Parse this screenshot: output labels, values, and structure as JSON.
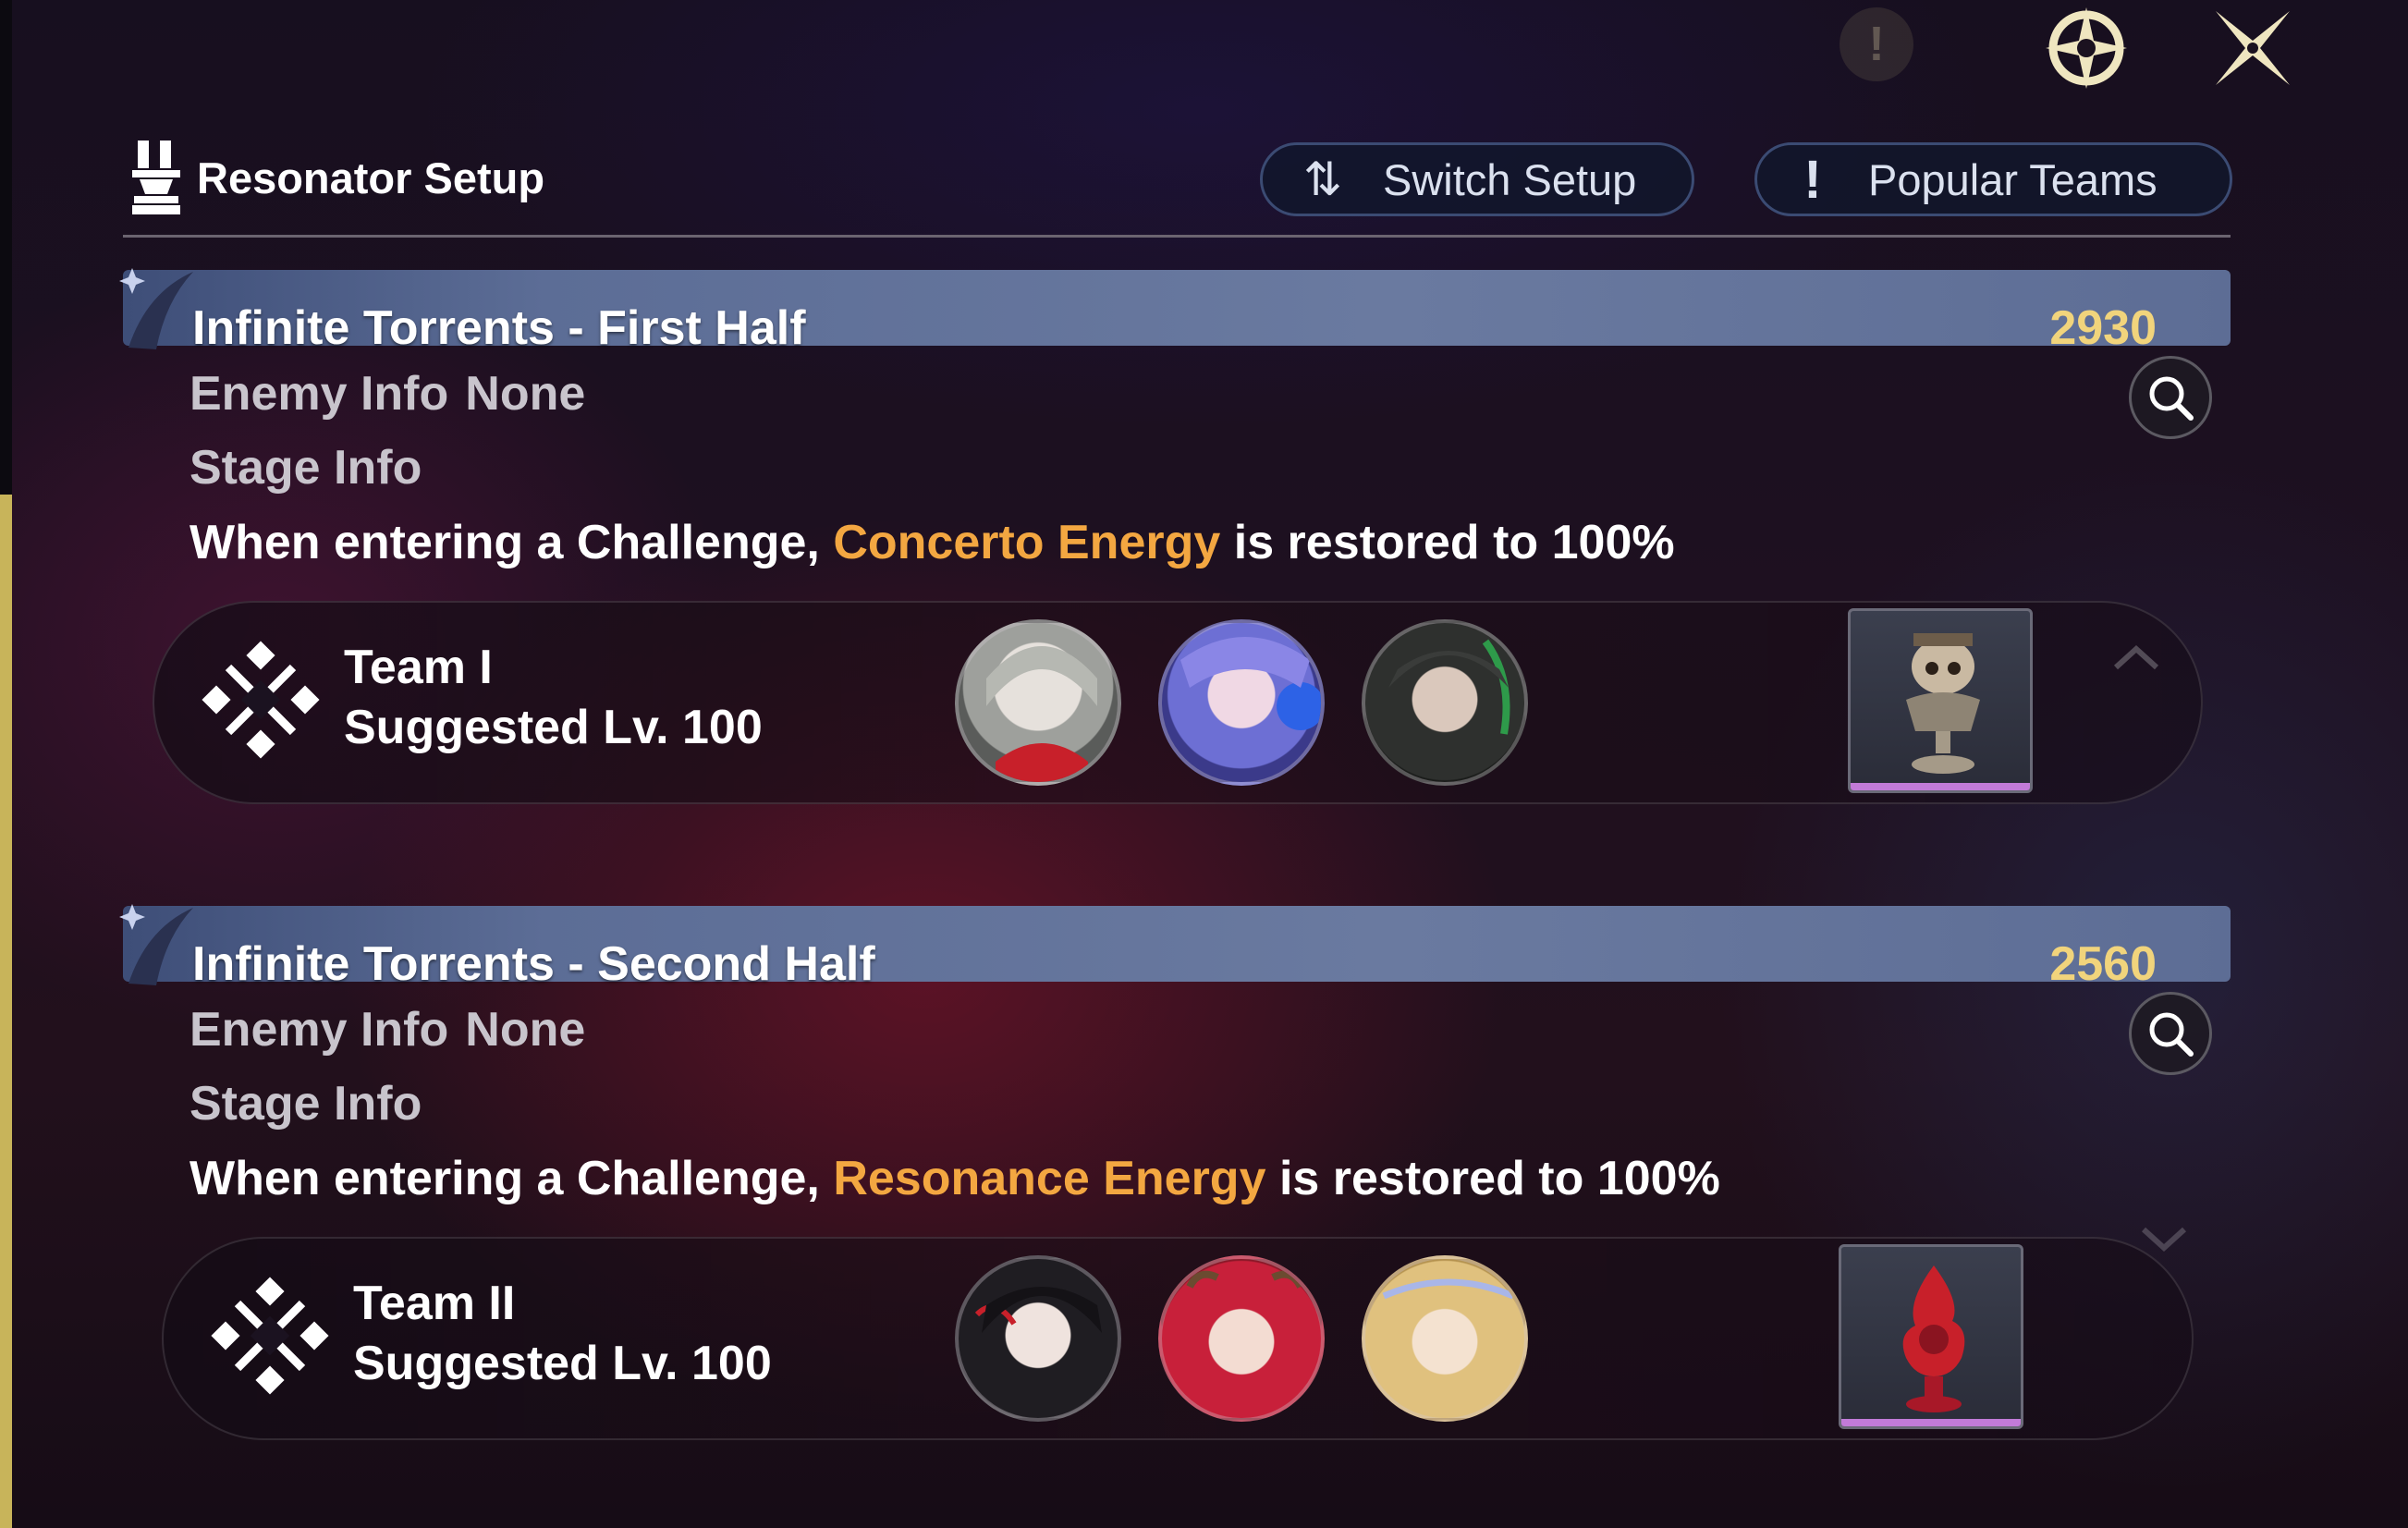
{
  "header": {
    "title": "Resonator Setup",
    "switch_label": "Switch Setup",
    "popular_label": "Popular Teams"
  },
  "sections": [
    {
      "title": "Infinite Torrents - First Half",
      "score": "2930",
      "enemy_label": "Enemy Info",
      "enemy_value": "None",
      "stage_label": "Stage Info",
      "effect_prefix": "When entering a Challenge, ",
      "effect_highlight": "Concerto Energy",
      "effect_suffix": " is restored to 100%",
      "team": {
        "name": "Team I",
        "level": "Suggested Lv. 100",
        "members": [
          "portrait-1",
          "portrait-2",
          "portrait-3"
        ],
        "echo": "skull-bust-echo-icon"
      }
    },
    {
      "title": "Infinite Torrents - Second Half",
      "score": "2560",
      "enemy_label": "Enemy Info",
      "enemy_value": "None",
      "stage_label": "Stage Info",
      "effect_prefix": "When entering a Challenge, ",
      "effect_highlight": "Resonance Energy",
      "effect_suffix": " is restored to 100%",
      "team": {
        "name": "Team II",
        "level": "Suggested Lv. 100",
        "members": [
          "portrait-4",
          "portrait-5",
          "portrait-6"
        ],
        "echo": "flame-echo-icon"
      }
    }
  ],
  "colors": {
    "score": "#f1d47c",
    "highlight": "#f3a741",
    "section_bar": "#5c6d96",
    "chip_rarity": "#c27bd8"
  }
}
